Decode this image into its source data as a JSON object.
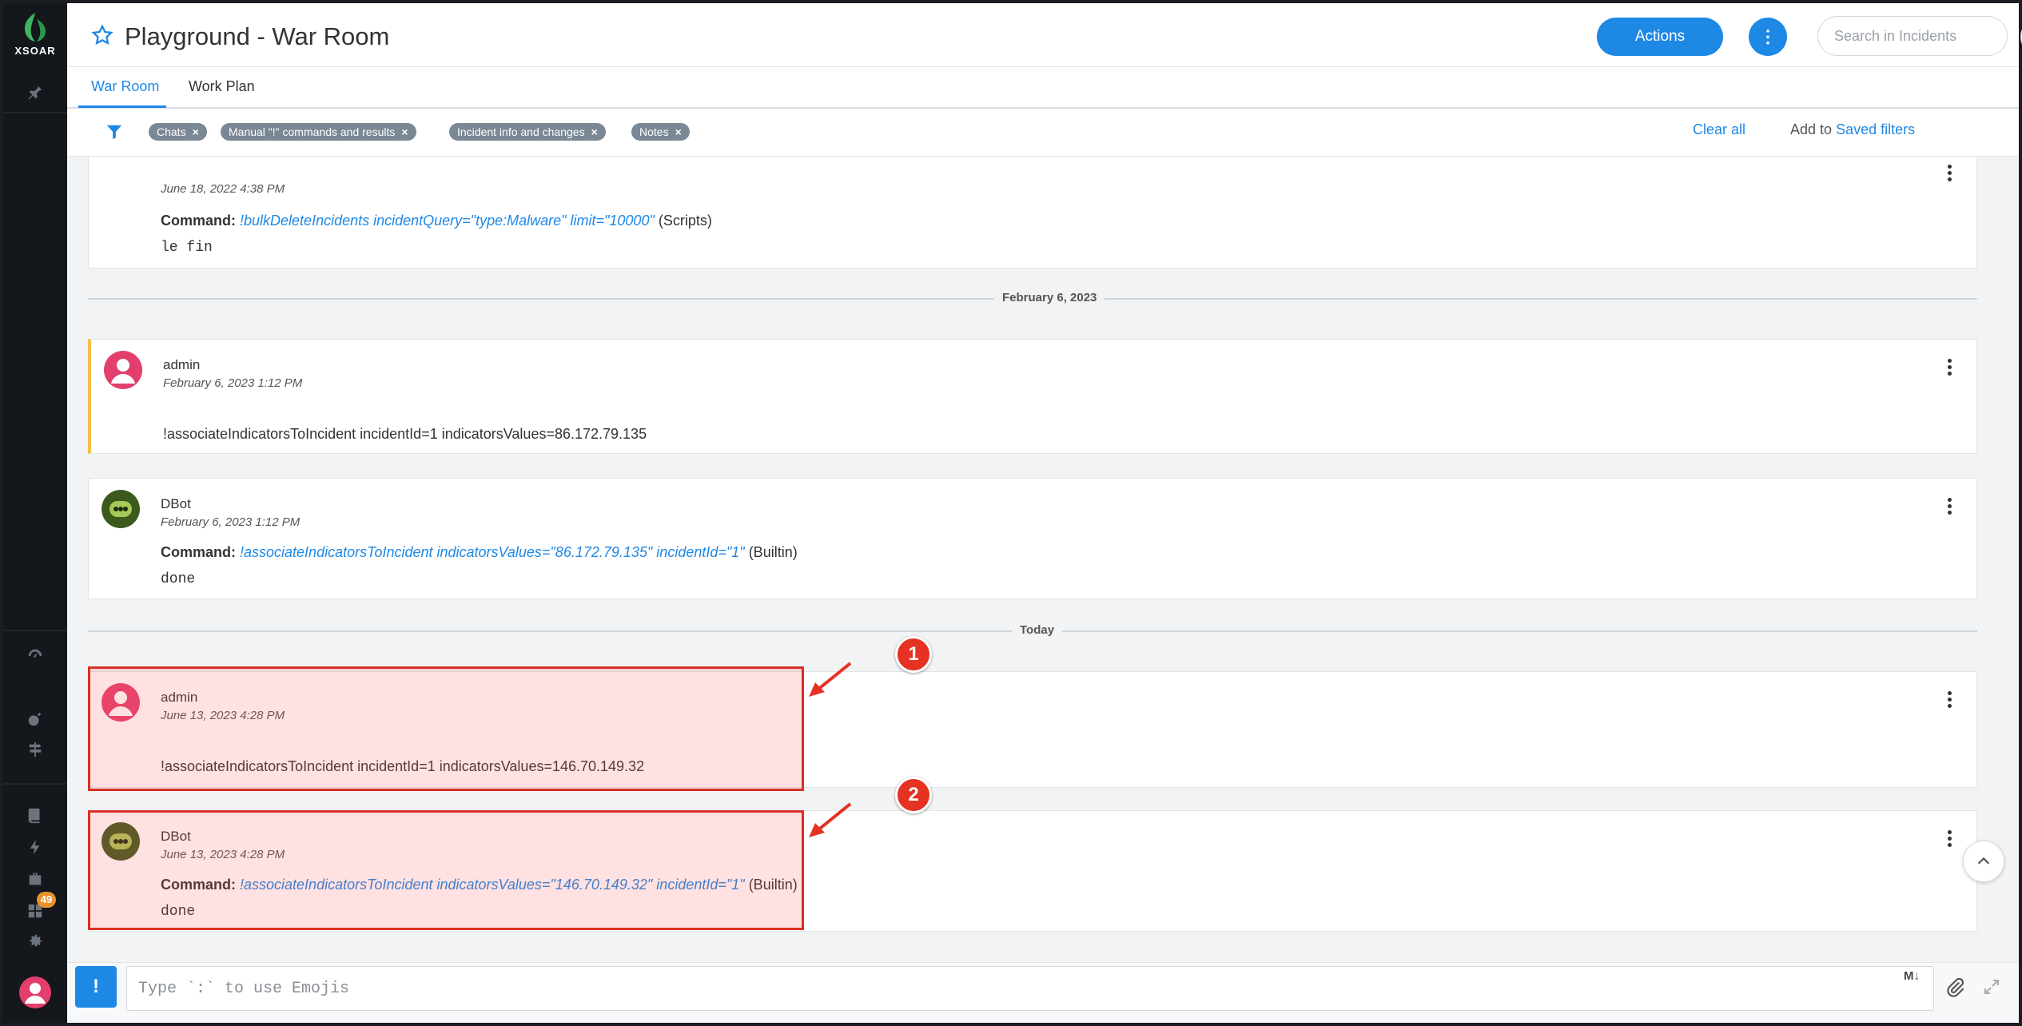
{
  "app": {
    "logo_text": "XSOAR",
    "title": "Playground - War Room",
    "notification_count": "49"
  },
  "header": {
    "actions_label": "Actions",
    "more_label": "⋮",
    "search_placeholder": "Search in Incidents",
    "help_label": "?"
  },
  "tabs": [
    {
      "label": "War Room",
      "active": true
    },
    {
      "label": "Work Plan",
      "active": false
    }
  ],
  "filters": {
    "chips": [
      {
        "label": "Chats"
      },
      {
        "label": "Manual \"!\" commands and results"
      },
      {
        "label": "Incident info and changes"
      },
      {
        "label": "Notes"
      }
    ],
    "clear_all": "Clear all",
    "add_to": "Add to",
    "saved_filters": "Saved filters"
  },
  "entries": [
    {
      "time": "June 18, 2022 4:38 PM",
      "command_label": "Command:",
      "command": "!bulkDeleteIncidents incidentQuery=\"type:Malware\" limit=\"10000\"",
      "source": "(Scripts)",
      "result": "le fin"
    },
    {
      "user": "admin",
      "time": "February 6, 2023 1:12 PM",
      "text": "!associateIndicatorsToIncident incidentId=1 indicatorsValues=86.172.79.135"
    },
    {
      "user": "DBot",
      "time": "February 6, 2023 1:12 PM",
      "command_label": "Command:",
      "command": "!associateIndicatorsToIncident indicatorsValues=\"86.172.79.135\" incidentId=\"1\"",
      "source": "(Builtin)",
      "result": "done"
    },
    {
      "user": "admin",
      "time": "June 13, 2023 4:28 PM",
      "text": "!associateIndicatorsToIncident incidentId=1 indicatorsValues=146.70.149.32"
    },
    {
      "user": "DBot",
      "time": "June 13, 2023 4:28 PM",
      "command_label": "Command:",
      "command": "!associateIndicatorsToIncident indicatorsValues=\"146.70.149.32\" incidentId=\"1\"",
      "source": "(Builtin)",
      "result": "done"
    }
  ],
  "dividers": [
    "February 6, 2023",
    "Today"
  ],
  "annotations": [
    "1",
    "2"
  ],
  "composer": {
    "bang_label": "!",
    "placeholder": "Type `:` to use Emojis",
    "markdown_label": "M↓"
  },
  "colors": {
    "accent": "#1e88e5",
    "sidebar": "#14171b",
    "highlight": "#d93025",
    "admin_avatar": "#e33f6e",
    "dbot_avatar": "#3d5a1e"
  }
}
